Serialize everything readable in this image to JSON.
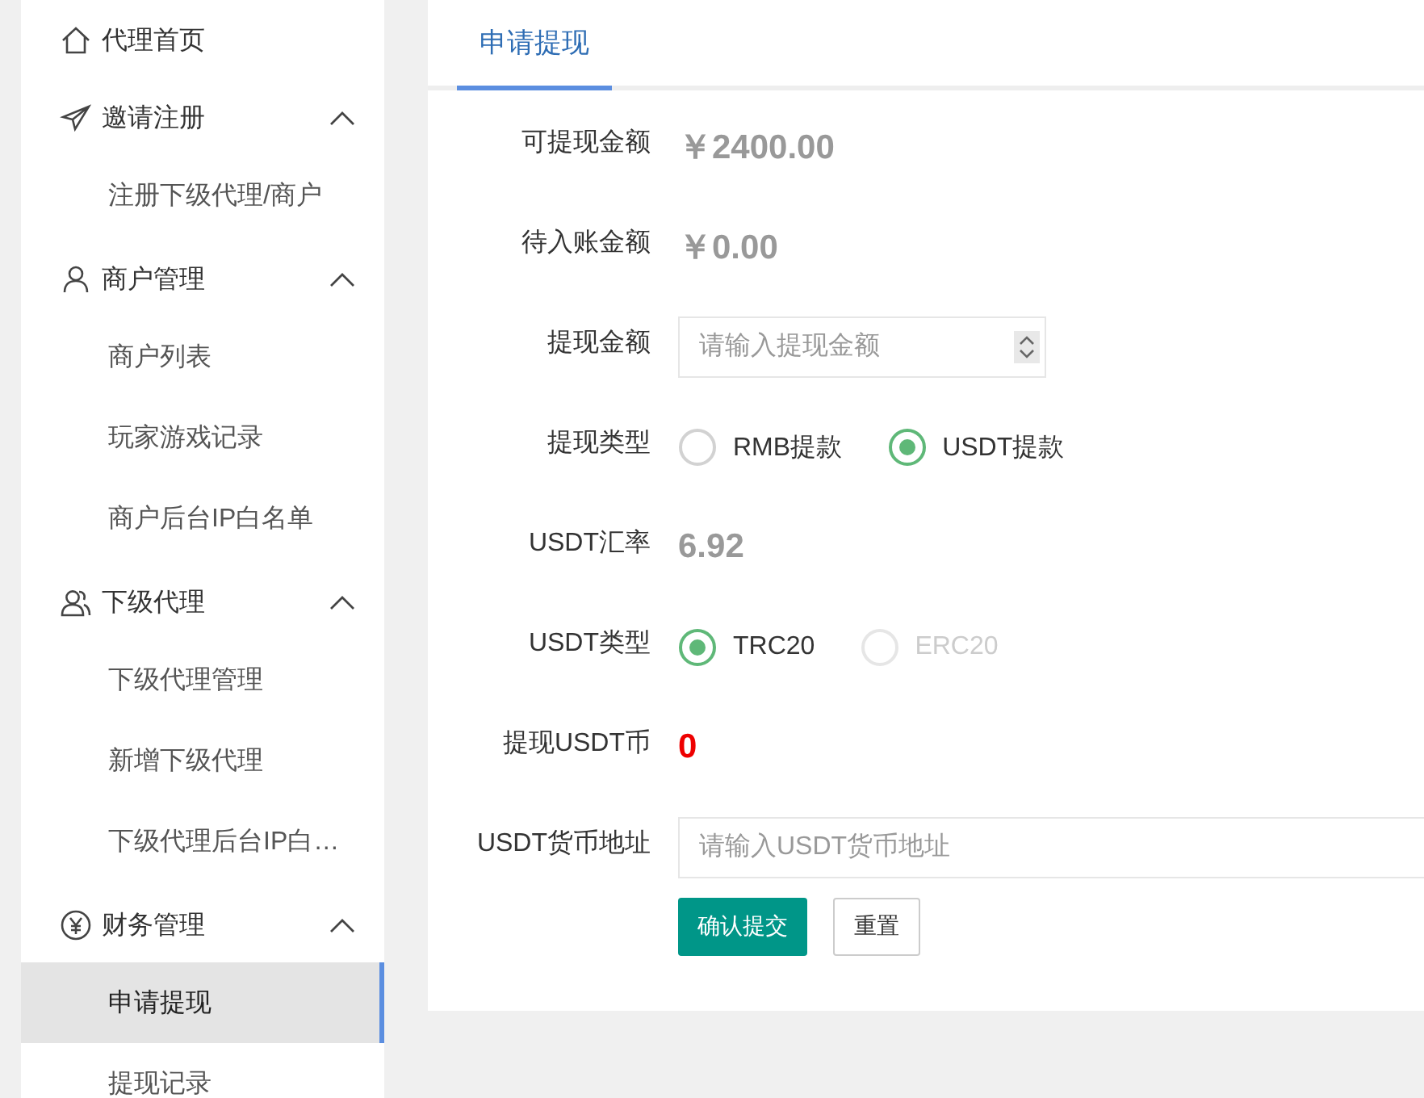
{
  "sidebar": {
    "items": [
      {
        "kind": "link",
        "label": "代理首页"
      },
      {
        "kind": "group",
        "label": "邀请注册",
        "expanded": true,
        "children": [
          {
            "label": "注册下级代理/商户",
            "selected": false
          }
        ]
      },
      {
        "kind": "group",
        "label": "商户管理",
        "expanded": true,
        "children": [
          {
            "label": "商户列表",
            "selected": false
          },
          {
            "label": "玩家游戏记录",
            "selected": false
          },
          {
            "label": "商户后台IP白名单",
            "selected": false
          }
        ]
      },
      {
        "kind": "group",
        "label": "下级代理",
        "expanded": true,
        "children": [
          {
            "label": "下级代理管理",
            "selected": false
          },
          {
            "label": "新增下级代理",
            "selected": false
          },
          {
            "label": "下级代理后台IP白…",
            "selected": false
          }
        ]
      },
      {
        "kind": "group",
        "label": "财务管理",
        "expanded": true,
        "children": [
          {
            "label": "申请提现",
            "selected": true
          },
          {
            "label": "提现记录",
            "selected": false
          }
        ]
      }
    ]
  },
  "tabs": [
    {
      "label": "申请提现",
      "selected": true
    }
  ],
  "form": {
    "fields": [
      {
        "kind": "value",
        "label": "可提现金额",
        "value": "￥2400.00"
      },
      {
        "kind": "value",
        "label": "待入账金额",
        "value": "￥0.00"
      },
      {
        "kind": "number",
        "label": "提现金额",
        "placeholder": "请输入提现金额"
      },
      {
        "kind": "radio",
        "label": "提现类型",
        "options": [
          {
            "label": "RMB提款",
            "selected": false,
            "disabled": false
          },
          {
            "label": "USDT提款",
            "selected": true,
            "disabled": false
          }
        ]
      },
      {
        "kind": "value",
        "label": "USDT汇率",
        "value": "6.92"
      },
      {
        "kind": "radio",
        "label": "USDT类型",
        "options": [
          {
            "label": "TRC20",
            "selected": true,
            "disabled": false
          },
          {
            "label": "ERC20",
            "selected": false,
            "disabled": true
          }
        ]
      },
      {
        "kind": "alert",
        "label": "提现USDT币",
        "value": "0"
      },
      {
        "kind": "text",
        "label": "USDT货币地址",
        "placeholder": "请输入USDT货币地址"
      }
    ],
    "buttons": [
      {
        "kind": "primary",
        "label": "确认提交"
      },
      {
        "kind": "default",
        "label": "重置"
      }
    ]
  }
}
